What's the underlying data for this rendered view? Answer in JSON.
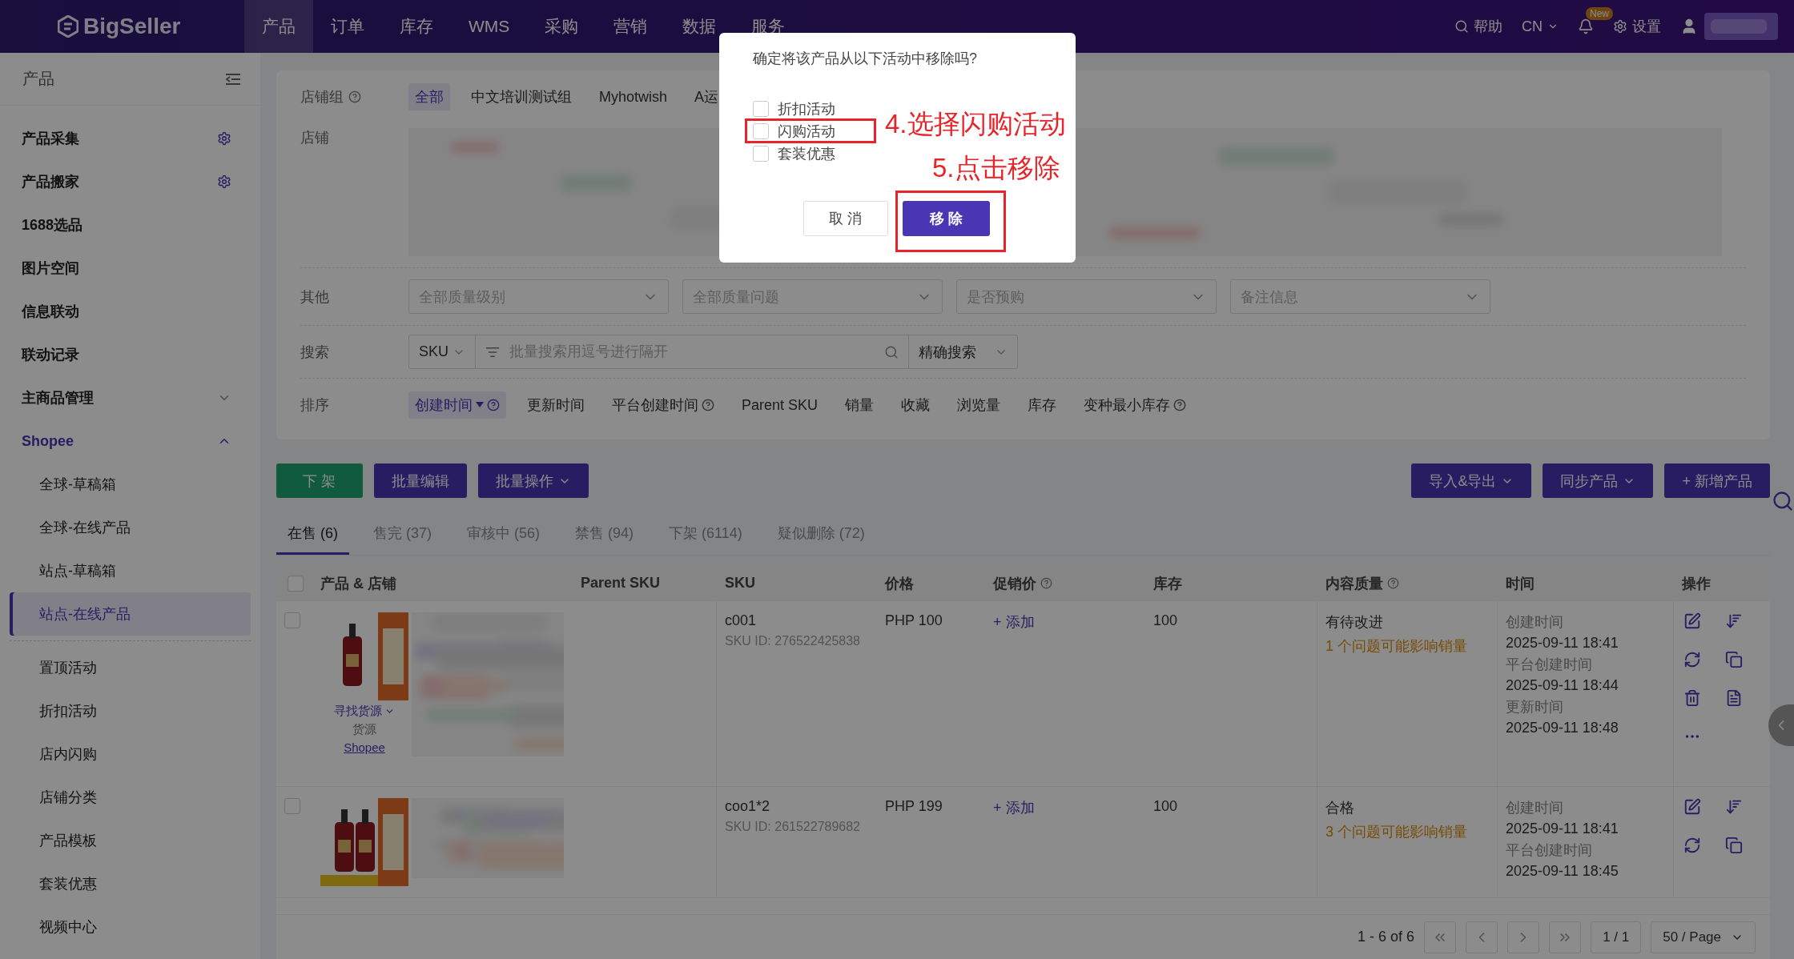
{
  "nav": {
    "logo": "BigSeller",
    "items": [
      {
        "label": "产品",
        "selected": true
      },
      {
        "label": "订单",
        "selected": false
      },
      {
        "label": "库存",
        "selected": false
      },
      {
        "label": "WMS",
        "selected": false
      },
      {
        "label": "采购",
        "selected": false
      },
      {
        "label": "营销",
        "selected": false
      },
      {
        "label": "数据",
        "selected": false
      },
      {
        "label": "服务",
        "selected": false
      }
    ],
    "help": "帮助",
    "language": "CN",
    "badge": "New",
    "settings": "设置"
  },
  "sidebar": {
    "title": "产品",
    "items": [
      {
        "label": "产品采集",
        "kind": "setting"
      },
      {
        "label": "产品搬家",
        "kind": "setting"
      },
      {
        "label": "1688选品",
        "kind": "plain"
      },
      {
        "label": "图片空间",
        "kind": "plain"
      },
      {
        "label": "信息联动",
        "kind": "plain"
      },
      {
        "label": "联动记录",
        "kind": "plain"
      },
      {
        "label": "主商品管理",
        "kind": "group",
        "expanded": false
      },
      {
        "label": "Shopee",
        "kind": "group",
        "expanded": true,
        "children": [
          {
            "label": "全球-草稿箱",
            "selected": false
          },
          {
            "label": "全球-在线产品",
            "selected": false
          },
          {
            "label": "站点-草稿箱",
            "selected": false
          },
          {
            "label": "站点-在线产品",
            "selected": true
          }
        ],
        "tools": [
          "置顶活动",
          "折扣活动",
          "店内闪购",
          "店铺分类",
          "产品模板",
          "套装优惠",
          "视频中心"
        ]
      }
    ]
  },
  "filters": {
    "store_group": {
      "label": "店铺组",
      "options": [
        {
          "label": "全部",
          "selected": true
        },
        {
          "label": "中文培训测试组",
          "selected": false
        },
        {
          "label": "Myhotwish",
          "selected": false
        },
        {
          "label": "A运",
          "selected": false
        }
      ]
    },
    "store": {
      "label": "店铺"
    },
    "other": {
      "label": "其他",
      "selects": [
        "全部质量级别",
        "全部质量问题",
        "是否预购",
        "备注信息"
      ]
    },
    "search": {
      "label": "搜索",
      "field": "SKU",
      "placeholder": "批量搜索用逗号进行隔开",
      "mode": "精确搜索"
    },
    "sort": {
      "label": "排序",
      "options": [
        {
          "label": "创建时间",
          "selected": true,
          "help": true
        },
        {
          "label": "更新时间",
          "selected": false,
          "help": false
        },
        {
          "label": "平台创建时间",
          "selected": false,
          "help": true
        },
        {
          "label": "Parent SKU",
          "selected": false,
          "help": false
        },
        {
          "label": "销量",
          "selected": false,
          "help": false
        },
        {
          "label": "收藏",
          "selected": false,
          "help": false
        },
        {
          "label": "浏览量",
          "selected": false,
          "help": false
        },
        {
          "label": "库存",
          "selected": false,
          "help": false
        },
        {
          "label": "变种最小库存",
          "selected": false,
          "help": true
        }
      ]
    }
  },
  "actions_left": [
    {
      "label": "下 架",
      "kind": "green",
      "menu": false
    },
    {
      "label": "批量编辑",
      "kind": "purple",
      "menu": false
    },
    {
      "label": "批量操作",
      "kind": "purple",
      "menu": true
    }
  ],
  "actions_right": [
    {
      "label": "导入&导出",
      "kind": "purple",
      "menu": true
    },
    {
      "label": "同步产品",
      "kind": "purple",
      "menu": true
    },
    {
      "label": "+ 新增产品",
      "kind": "purple",
      "menu": false
    }
  ],
  "tabs": [
    {
      "label": "在售 (6)",
      "selected": true
    },
    {
      "label": "售完 (37)",
      "selected": false
    },
    {
      "label": "审核中 (56)",
      "selected": false
    },
    {
      "label": "禁售 (94)",
      "selected": false
    },
    {
      "label": "下架 (6114)",
      "selected": false
    },
    {
      "label": "疑似删除 (72)",
      "selected": false
    }
  ],
  "table": {
    "all_checked": false,
    "columns": [
      {
        "label": "产品 & 店铺",
        "help": false
      },
      {
        "label": "Parent SKU",
        "help": false
      },
      {
        "label": "SKU",
        "help": false
      },
      {
        "label": "价格",
        "help": false
      },
      {
        "label": "促销价",
        "help": true
      },
      {
        "label": "库存",
        "help": false
      },
      {
        "label": "内容质量",
        "help": true
      },
      {
        "label": "时间",
        "help": false
      },
      {
        "label": "操作",
        "help": false
      }
    ],
    "rows": [
      {
        "checked": false,
        "source": "寻找货源",
        "source_label": "货源",
        "platform": "Shopee",
        "sku": "c001",
        "sku_id": "SKU ID: 276522425838",
        "price": "PHP 100",
        "promo": "+ 添加",
        "stock": "100",
        "quality": "有待改进",
        "issue": "1 个问题可能影响销量",
        "times": [
          "创建时间",
          "2025-09-11 18:41",
          "平台创建时间",
          "2025-09-11 18:44",
          "更新时间",
          "2025-09-11 18:48"
        ]
      },
      {
        "checked": false,
        "sku": "coo1*2",
        "sku_id": "SKU ID: 261522789682",
        "price": "PHP 199",
        "promo": "+ 添加",
        "stock": "100",
        "quality": "合格",
        "issue": "3 个问题可能影响销量",
        "times": [
          "创建时间",
          "2025-09-11 18:41",
          "平台创建时间",
          "2025-09-11 18:45"
        ]
      }
    ]
  },
  "pagination": {
    "range": "1 - 6 of 6",
    "page": "1 / 1",
    "size": "50 / Page"
  },
  "dialog": {
    "question": "确定将该产品从以下活动中移除吗?",
    "options": [
      {
        "label": "折扣活动",
        "checked": false
      },
      {
        "label": "闪购活动",
        "checked": false
      },
      {
        "label": "套装优惠",
        "checked": false
      }
    ],
    "cancel": "取 消",
    "confirm": "移 除"
  },
  "annotations": [
    "4.选择闪购活动",
    "5.点击移除"
  ]
}
